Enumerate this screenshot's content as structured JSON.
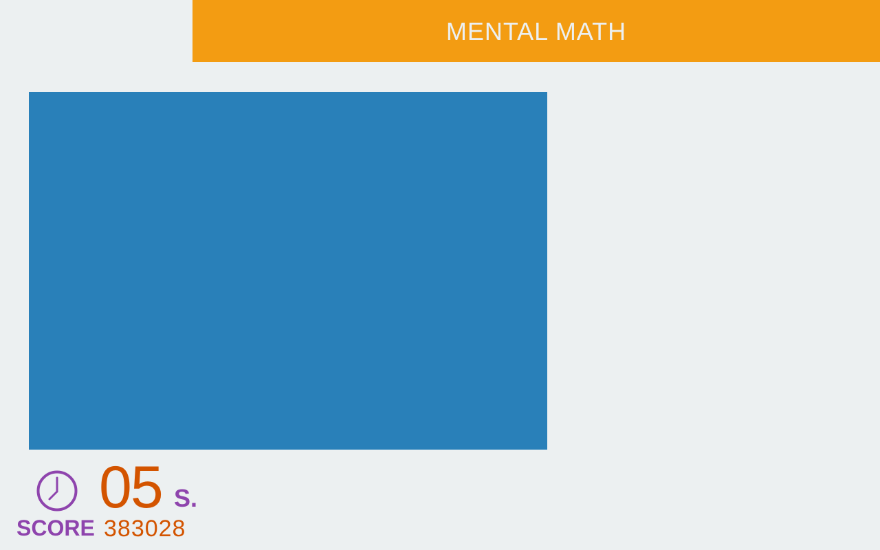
{
  "header": {
    "title": "MENTAL MATH"
  },
  "timer": {
    "value": "05",
    "unit": "S.",
    "icon": "clock-icon"
  },
  "score": {
    "label": "SCORE",
    "value": "383028"
  },
  "colors": {
    "background": "#ecf0f1",
    "header": "#f39c12",
    "board": "#2980b9",
    "accent_purple": "#8e44ad",
    "accent_orange": "#d35400"
  }
}
